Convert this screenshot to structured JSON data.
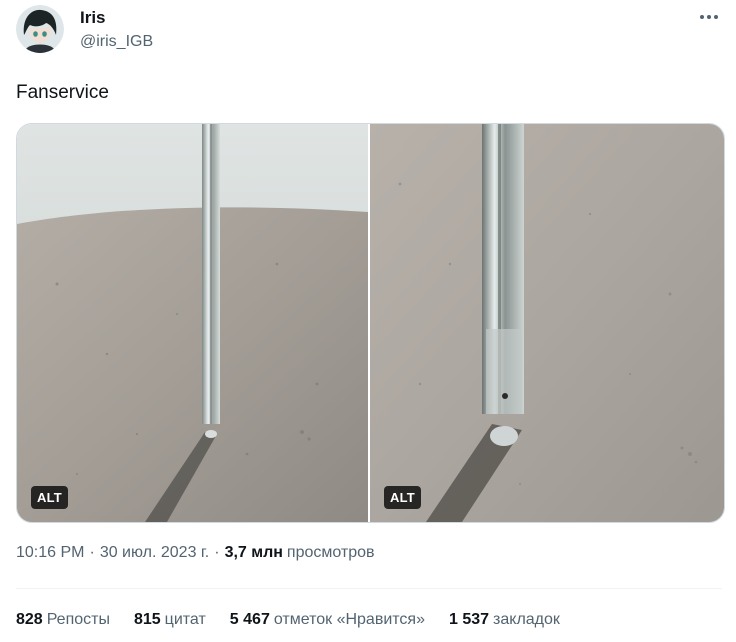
{
  "author": {
    "name": "Iris",
    "handle": "@iris_IGB"
  },
  "tweet": {
    "text": "Fanservice"
  },
  "media": {
    "photos": [
      {
        "alt_badge": "ALT"
      },
      {
        "alt_badge": "ALT"
      }
    ]
  },
  "meta": {
    "time": "10:16 PM",
    "separator": "·",
    "date": "30 июл. 2023 г.",
    "views_count": "3,7 млн",
    "views_label": "просмотров"
  },
  "stats": [
    {
      "count": "828",
      "label": "Репосты"
    },
    {
      "count": "815",
      "label": "цитат"
    },
    {
      "count": "5 467",
      "label": "отметок «Нравится»"
    },
    {
      "count": "1 537",
      "label": "закладок"
    }
  ],
  "colors": {
    "text_primary": "#0f1419",
    "text_secondary": "#536471",
    "border": "#cfd9de"
  },
  "icons": {
    "more": "more-horizontal-icon"
  }
}
